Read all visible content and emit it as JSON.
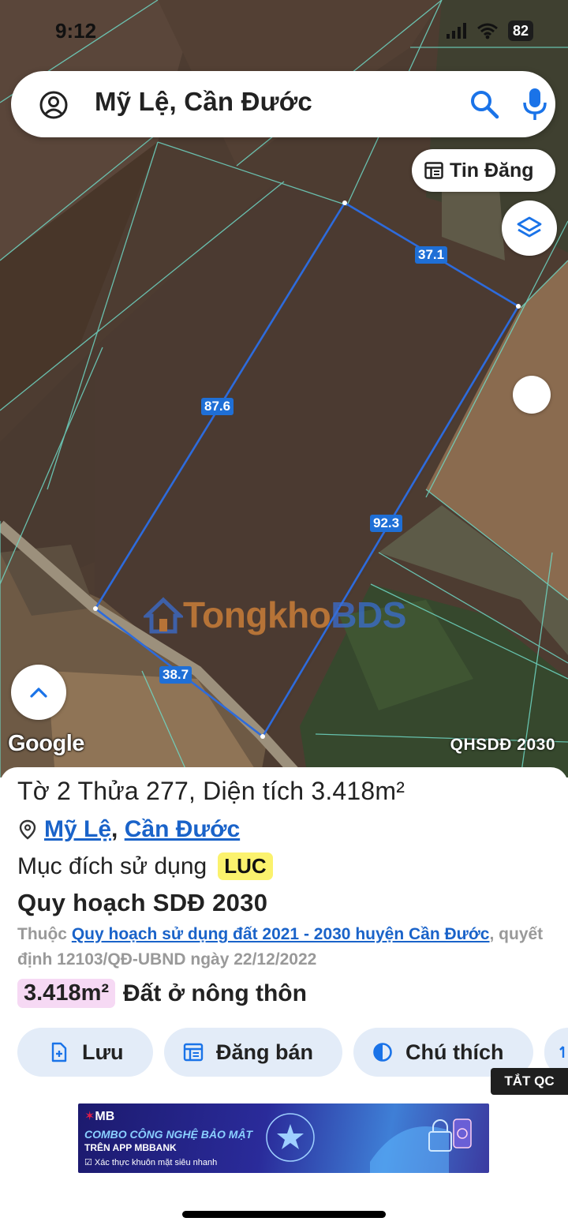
{
  "status_bar": {
    "time": "9:12",
    "battery": "82"
  },
  "search": {
    "query": "Mỹ Lệ, Cần Đước"
  },
  "map": {
    "tin_dang_label": "Tin Đăng",
    "dimension_labels": [
      "37.1",
      "87.6",
      "92.3",
      "38.7"
    ],
    "attribution": "Google",
    "layer_label": "QHSDĐ 2030",
    "watermark_a": "Tongkho",
    "watermark_b": "BDS"
  },
  "panel": {
    "parcel_title": "Tờ 2 Thửa 277, Diện tích 3.418m²",
    "location": {
      "commune": "Mỹ Lệ",
      "separator": ",",
      "district": "Cần Đước"
    },
    "purpose_label": "Mục đích sử dụng",
    "purpose_code": "LUC",
    "plan_title": "Quy hoạch SDĐ 2030",
    "plan_prefix": "Thuộc",
    "plan_link": "Quy hoạch sử dụng đất 2021 - 2030 huyện Cần Đước",
    "plan_suffix": ", quyết định 12103/QĐ-UBND ngày 22/12/2022",
    "land_area": "3.418m²",
    "land_type": "Đất ở nông thôn",
    "actions": [
      {
        "label": "Lưu",
        "icon": "save-file-icon"
      },
      {
        "label": "Đăng bán",
        "icon": "listing-icon"
      },
      {
        "label": "Chú thích",
        "icon": "legend-contrast-icon"
      }
    ],
    "hide_ads_label": "TẮT QC"
  },
  "ad": {
    "brand": "MB",
    "line1": "COMBO CÔNG NGHỆ BẢO MẬT",
    "line2": "TRÊN APP MBBANK",
    "line3": "Xác thực khuôn mặt siêu nhanh",
    "seal_text": "ĐẦU TIÊN DUY NHẤT"
  },
  "colors": {
    "link": "#1a63c9",
    "badge_luc": "#fbf26d",
    "badge_area": "#f6d9f4",
    "boundary": "#1f6fd6",
    "action_bg": "#e3ecf8"
  }
}
